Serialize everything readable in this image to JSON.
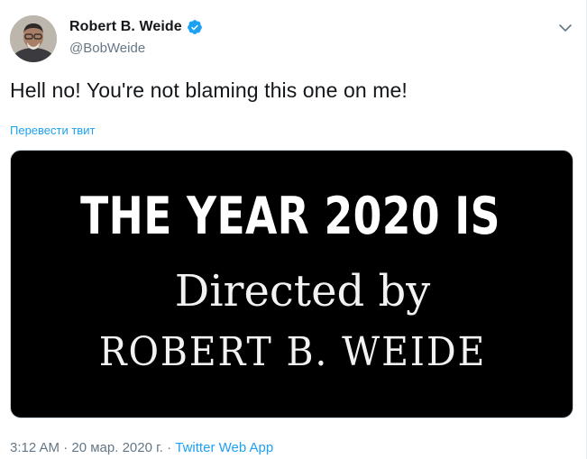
{
  "tweet": {
    "author": {
      "display_name": "Robert B. Weide",
      "handle": "@BobWeide",
      "verified": true
    },
    "text": "Hell no! You're not blaming this one on me!",
    "translate_label": "Перевести твит",
    "image_text": {
      "line1": "THE YEAR 2020 IS",
      "line2": "Directed by",
      "line3": "ROBERT B. WEIDE"
    },
    "time": "3:12 AM",
    "separator": "·",
    "date": "20 мар. 2020 г.",
    "source": "Twitter Web App"
  },
  "icons": {
    "verified": "verified-badge-icon",
    "menu": "chevron-down-icon"
  },
  "colors": {
    "accent": "#1da1f2",
    "text_primary": "#14171a",
    "text_secondary": "#657786",
    "media_bg": "#000000"
  }
}
